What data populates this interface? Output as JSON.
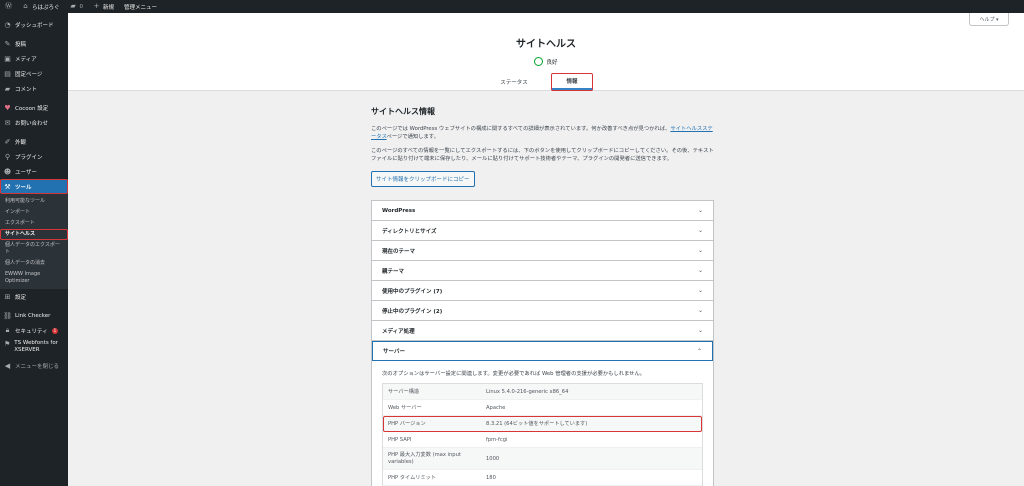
{
  "adminbar": {
    "site_name": "らはぷろぐ",
    "comments_count": "0",
    "new_label": "新規",
    "admin_menu_label": "管理メニュー"
  },
  "sidebar": {
    "dashboard": "ダッシュボード",
    "posts": "投稿",
    "media": "メディア",
    "pages": "固定ページ",
    "comments": "コメント",
    "cocoon": "Cocoon 設定",
    "contact": "お問い合わせ",
    "appearance": "外観",
    "plugins": "プラグイン",
    "users": "ユーザー",
    "tools": "ツール",
    "tools_sub": [
      "利用可能なツール",
      "インポート",
      "エクスポート",
      "サイトヘルス",
      "個人データのエクスポート",
      "個人データの消去",
      "EWWW Image Optimizer"
    ],
    "settings": "設定",
    "link_checker": "Link Checker",
    "security": "セキュリティ",
    "security_badge": "1",
    "ts_webfonts": "TS Webfonts for XSERVER",
    "collapse": "メニューを閉じる"
  },
  "header": {
    "title": "サイトヘルス",
    "status": "良好",
    "tab_status": "ステータス",
    "tab_info": "情報",
    "help": "ヘルプ ▾"
  },
  "main": {
    "heading": "サイトヘルス情報",
    "para1": "このページでは WordPress ウェブサイトの構成に関するすべての詳細が表示されています。何か改善すべき点が見つかれば、",
    "para1_link": "サイトヘルスステータス",
    "para1_end": "ページで通知します。",
    "para2": "このページのすべての情報を一覧にしてエクスポートするには、下のボタンを使用してクリップボードにコピーしてください。その後、テキストファイルに貼り付けて端末に保存したり、メールに貼り付けてサポート技術者やテーマ、プラグインの開発者に送信できます。",
    "copy_button": "サイト情報をクリップボードにコピー"
  },
  "accordion": {
    "sections": [
      "WordPress",
      "ディレクトリとサイズ",
      "現在のテーマ",
      "親テーマ",
      "使用中のプラグイン (7)",
      "停止中のプラグイン (2)",
      "メディア処理"
    ],
    "open_section": "サーバー",
    "server_desc": "次のオプションはサーバー設定に関連します。変更が必要であれば Web 管理者の支援が必要かもしれません。",
    "server_rows": [
      {
        "k": "サーバー構造",
        "v": "Linux 5.4.0-216-generic x86_64"
      },
      {
        "k": "Web サーバー",
        "v": "Apache"
      },
      {
        "k": "PHP バージョン",
        "v": "8.3.21 (64ビット値をサポートしています)"
      },
      {
        "k": "PHP SAPI",
        "v": "fpm-fcgi"
      },
      {
        "k": "PHP 最大入力変数 (max input variables)",
        "v": "1000"
      },
      {
        "k": "PHP タイムリミット",
        "v": "180"
      }
    ]
  },
  "colors": {
    "sidebar_bg": "#1d2327",
    "accent": "#2271b1",
    "highlight": "#d63638",
    "good": "#00a32a"
  }
}
